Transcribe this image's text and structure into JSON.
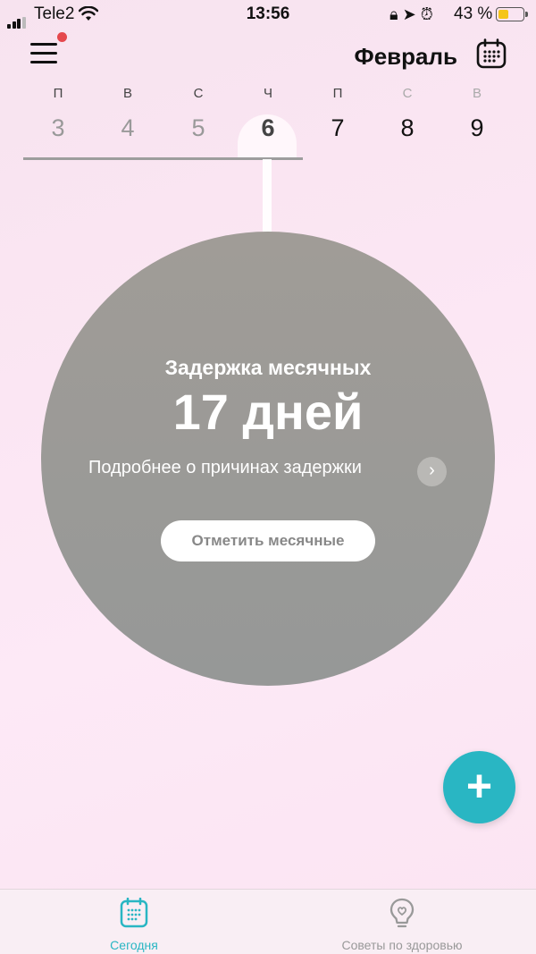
{
  "status_bar": {
    "carrier": "Tele2",
    "time": "13:56",
    "battery_percent": "43 %",
    "battery_level": 0.43,
    "icons": [
      "signal-icon",
      "wifi-icon",
      "orientation-lock-icon",
      "location-icon",
      "alarm-icon",
      "battery-icon"
    ]
  },
  "header": {
    "month": "Февраль",
    "has_notification": true
  },
  "week": {
    "days": [
      {
        "letter": "П",
        "number": "3"
      },
      {
        "letter": "В",
        "number": "4"
      },
      {
        "letter": "С",
        "number": "5"
      },
      {
        "letter": "Ч",
        "number": "6"
      },
      {
        "letter": "П",
        "number": "7"
      },
      {
        "letter": "С",
        "number": "8"
      },
      {
        "letter": "В",
        "number": "9"
      }
    ],
    "selected": "6"
  },
  "cycle": {
    "title": "Задержка месячных",
    "value": "17 дней",
    "link": "Подробнее о причинах задержки",
    "button": "Отметить месячные"
  },
  "fab": {
    "label": "+"
  },
  "tabs": [
    {
      "label": "Сегодня",
      "icon": "calendar-icon",
      "active": true
    },
    {
      "label": "Советы по здоровью",
      "icon": "lightbulb-heart-icon",
      "active": false
    }
  ],
  "colors": {
    "accent": "#29b6c3",
    "circle": "#9a9a97",
    "notification": "#e5484d"
  }
}
